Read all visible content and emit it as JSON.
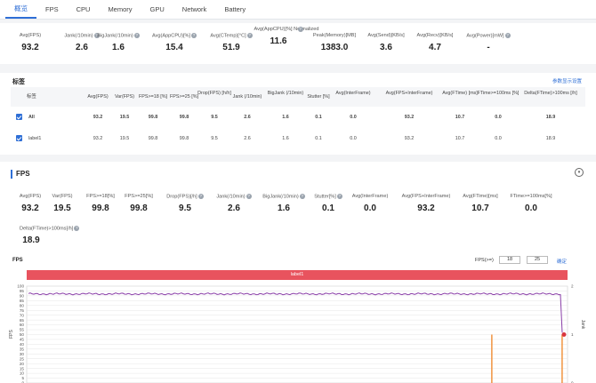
{
  "tabs": [
    "概览",
    "FPS",
    "CPU",
    "Memory",
    "GPU",
    "Network",
    "Battery"
  ],
  "summary": [
    {
      "label": "Avg(FPS)",
      "value": "93.2",
      "help": false
    },
    {
      "label": "Jank(/10min)",
      "value": "2.6",
      "help": true
    },
    {
      "label": "BigJank(/10min)",
      "value": "1.6",
      "help": true
    },
    {
      "label": "Avg(AppCPU)[%]",
      "value": "15.4",
      "help": true
    },
    {
      "label": "Avg(CTemp)[°C]",
      "value": "51.9",
      "help": true
    },
    {
      "label": "Avg(AppCPU)[%] Normalized",
      "value": "11.6",
      "help": true
    },
    {
      "label": "Peak(Memory)[MB]",
      "value": "1383.0",
      "help": false
    },
    {
      "label": "Avg(Send)[KB/s]",
      "value": "3.6",
      "help": false
    },
    {
      "label": "Avg(Recv)[KB/s]",
      "value": "4.7",
      "help": false
    },
    {
      "label": "Avg(Power)[mW]",
      "value": "-",
      "help": true
    }
  ],
  "labels_section": {
    "title": "标签",
    "settings_link": "参数显示设置",
    "columns": [
      "标签",
      "Avg(FPS)",
      "Var(FPS)",
      "FPS>=18 [%]",
      "FPS>=25 [%]",
      "Drop(FPS) [h/h]",
      "Jank (/10min)",
      "BigJank (/10min)",
      "Stutter [%]",
      "Avg(InterFrame)",
      "Avg(FPS+InterFrame)",
      "Avg(FTime) [ms]",
      "FTime>=100ms [%]",
      "Delta(FTime)>100ms [/h]"
    ],
    "rows": [
      {
        "name": "All",
        "values": [
          "93.2",
          "19.5",
          "99.8",
          "99.8",
          "9.5",
          "2.6",
          "1.6",
          "0.1",
          "0.0",
          "93.2",
          "10.7",
          "0.0",
          "18.9"
        ]
      },
      {
        "name": "label1",
        "values": [
          "93.2",
          "19.5",
          "99.8",
          "99.8",
          "9.5",
          "2.6",
          "1.6",
          "0.1",
          "0.0",
          "93.2",
          "10.7",
          "0.0",
          "18.9"
        ]
      }
    ]
  },
  "fps_section": {
    "title": "FPS",
    "metrics": [
      {
        "label": "Avg(FPS)",
        "value": "93.2",
        "help": false
      },
      {
        "label": "Var(FPS)",
        "value": "19.5",
        "help": false
      },
      {
        "label": "FPS>=18[%]",
        "value": "99.8",
        "help": false
      },
      {
        "label": "FPS>=25[%]",
        "value": "99.8",
        "help": false
      },
      {
        "label": "Drop(FPS)[/h]",
        "value": "9.5",
        "help": true
      },
      {
        "label": "Jank(/10min)",
        "value": "2.6",
        "help": true
      },
      {
        "label": "BigJank(/10min)",
        "value": "1.6",
        "help": true
      },
      {
        "label": "Stutter[%]",
        "value": "0.1",
        "help": true
      },
      {
        "label": "Avg(InterFrame)",
        "value": "0.0",
        "help": false
      },
      {
        "label": "Avg(FPS+InterFrame)",
        "value": "93.2",
        "help": false
      },
      {
        "label": "Avg(FTime)[ms]",
        "value": "10.7",
        "help": false
      },
      {
        "label": "FTime>=100ms[%]",
        "value": "0.0",
        "help": false
      }
    ],
    "delta": {
      "label": "Delta(FTime)>100ms[/h]",
      "value": "18.9"
    },
    "chart_label": "FPS",
    "fps_filter_label": "FPS(>=)",
    "fps_filter_a": "18",
    "fps_filter_b": "25",
    "confirm": "确定",
    "label_band": "label1"
  },
  "chart_data": {
    "type": "line",
    "ylabel": "FPS",
    "y2label": "Jank",
    "ylim": [
      0,
      100
    ],
    "yticks": [
      100,
      95,
      90,
      85,
      80,
      75,
      70,
      65,
      60,
      55,
      50,
      45,
      40,
      35,
      30,
      25,
      20,
      15,
      10,
      5,
      0
    ],
    "y2lim": [
      0,
      2
    ],
    "y2ticks": [
      2,
      1,
      0
    ],
    "series": [
      {
        "name": "FPS",
        "color": "#8a3fa8",
        "baseline": 92,
        "drop_at_end": 52
      },
      {
        "name": "Jank",
        "color": "#f08c32",
        "spikes": [
          {
            "t": 0.86,
            "v": 1
          },
          {
            "t": 0.99,
            "v": 1
          }
        ]
      }
    ],
    "grid": true
  }
}
